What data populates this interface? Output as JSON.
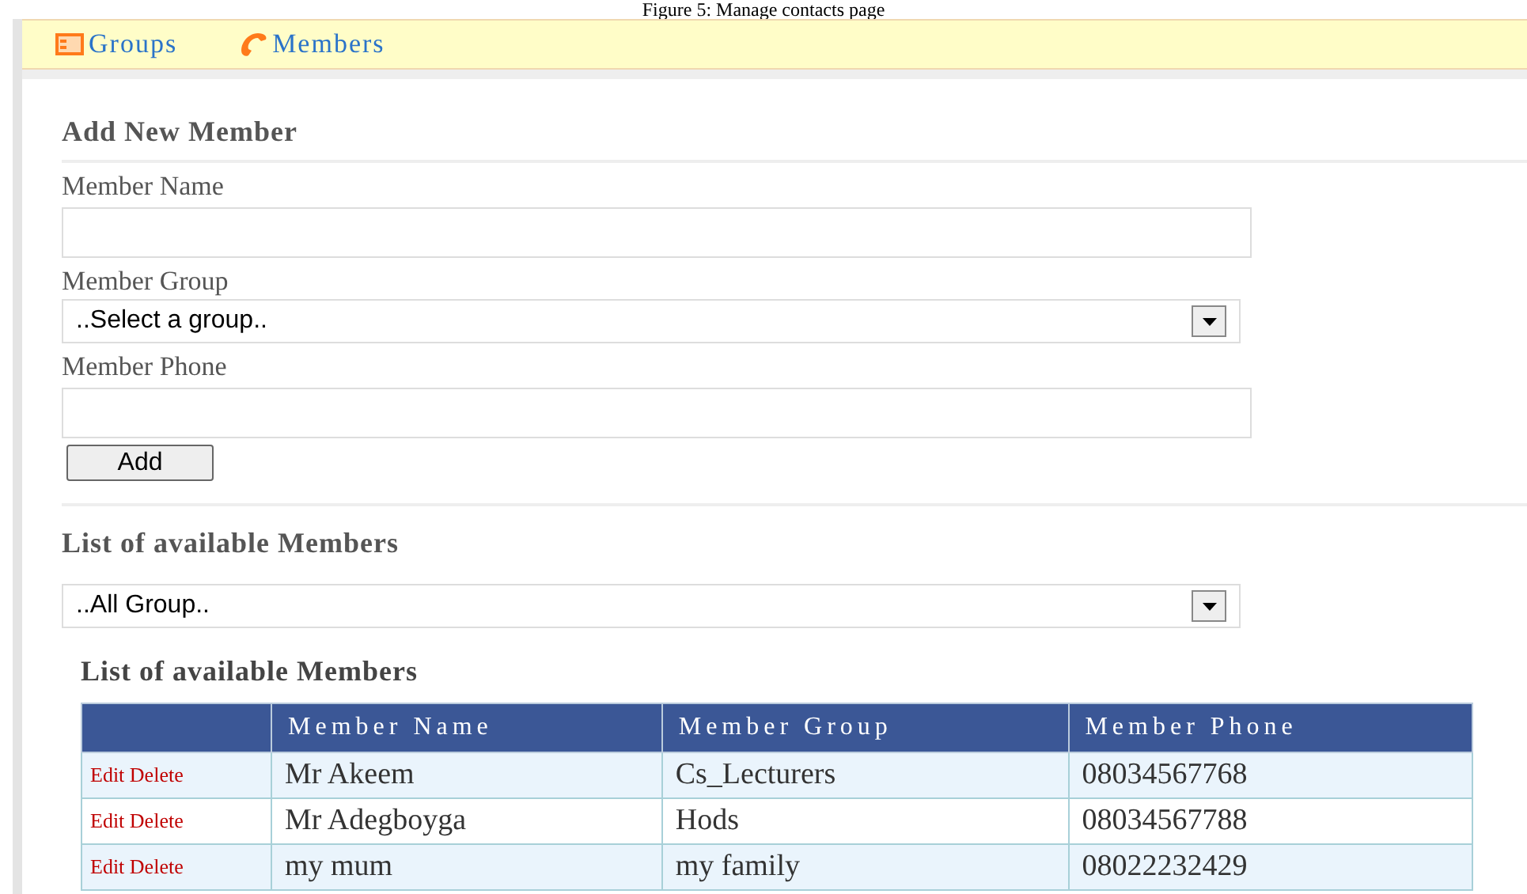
{
  "caption": "Figure 5: Manage contacts page",
  "nav": [
    {
      "label": "Groups",
      "kind": "groups"
    },
    {
      "label": "Members",
      "kind": "members"
    }
  ],
  "add_form": {
    "title": "Add New Member",
    "fields": [
      {
        "label": "Member Name",
        "kind": "text"
      },
      {
        "label": "Member Group",
        "kind": "select",
        "value": "..Select a group.."
      },
      {
        "label": "Member Phone",
        "kind": "text"
      }
    ],
    "button": "Add"
  },
  "list": {
    "title": "List of available Members",
    "filter": "..All Group..",
    "table_title": "List of available Members",
    "columns": [
      "Member Name",
      "Member Group",
      "Member Phone"
    ],
    "rows": [
      {
        "edit": "Edit",
        "delete": "Delete",
        "cells": [
          "Mr Akeem",
          "Cs_Lecturers",
          "08034567768"
        ]
      },
      {
        "edit": "Edit",
        "delete": "Delete",
        "cells": [
          "Mr Adegboyga",
          "Hods",
          "08034567788"
        ]
      },
      {
        "edit": "Edit",
        "delete": "Delete",
        "cells": [
          "my mum",
          "my family",
          "08022232429"
        ]
      }
    ]
  }
}
